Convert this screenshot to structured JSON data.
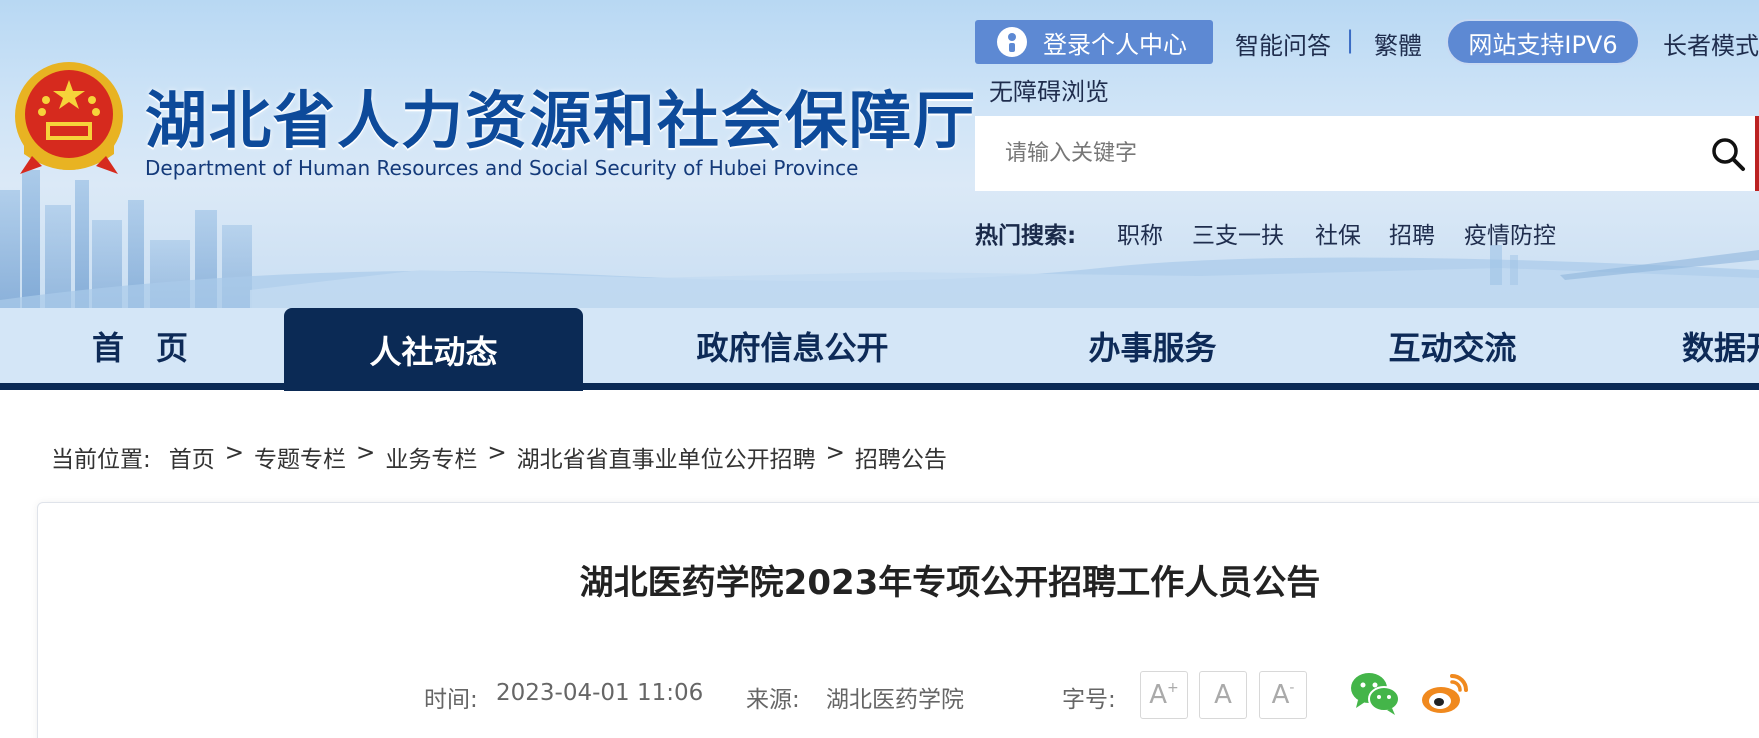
{
  "header": {
    "title": "湖北省人力资源和社会保障厅",
    "subtitle": "Department of Human Resources and Social Security of Hubei Province",
    "emblem_icon": "national-emblem-icon"
  },
  "toplinks": {
    "login": "登录个人中心",
    "ai_qa": "智能问答",
    "separator": "|",
    "traditional": "繁體",
    "ipv6": "网站支持IPV6",
    "elder_mode": "长者模式",
    "accessibility": "无障碍浏览"
  },
  "search": {
    "placeholder": "请输入关键字",
    "hot_label": "热门搜索:",
    "hot_items": [
      "职称",
      "三支一扶",
      "社保",
      "招聘",
      "疫情防控"
    ]
  },
  "nav": {
    "items": [
      "首　页",
      "人社动态",
      "政府信息公开",
      "办事服务",
      "互动交流",
      "数据开放"
    ],
    "active_index": 1
  },
  "breadcrumb": {
    "label": "当前位置:",
    "crumbs": [
      "首页",
      "专题专栏",
      "业务专栏",
      "湖北省省直事业单位公开招聘",
      "招聘公告"
    ],
    "arrow": ">"
  },
  "article": {
    "title": "湖北医药学院2023年专项公开招聘工作人员公告",
    "time_label": "时间:",
    "time": "2023-04-01 11:06",
    "source_label": "来源:",
    "source": "湖北医药学院",
    "font_size_label": "字号:",
    "font_buttons": [
      "A",
      "A",
      "A"
    ]
  },
  "colors": {
    "nav_dark": "#0b2a55",
    "nav_bg": "#d4e6f7",
    "login_bg": "#5d89d3",
    "title_blue": "#0d4a9a",
    "wechat_green": "#44b549",
    "weibo_orange": "#f0891e"
  },
  "share_icons": [
    "wechat-icon",
    "weibo-icon"
  ]
}
